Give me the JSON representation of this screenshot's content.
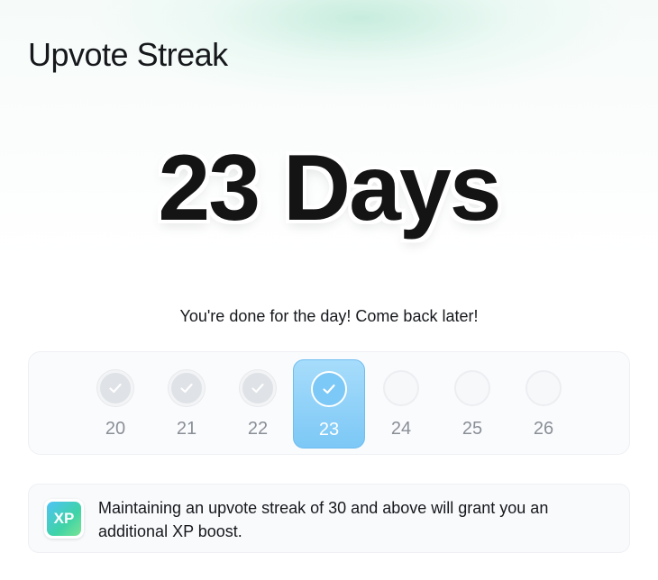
{
  "header": {
    "title": "Upvote Streak"
  },
  "streak": {
    "count_label": "23 Days",
    "message": "You're done for the day! Come back later!",
    "days": [
      {
        "label": "20",
        "state": "done"
      },
      {
        "label": "21",
        "state": "done"
      },
      {
        "label": "22",
        "state": "done"
      },
      {
        "label": "23",
        "state": "today"
      },
      {
        "label": "24",
        "state": "future"
      },
      {
        "label": "25",
        "state": "future"
      },
      {
        "label": "26",
        "state": "future"
      }
    ]
  },
  "info": {
    "badge_text": "XP",
    "text": "Maintaining an upvote streak of 30 and above will grant you an additional XP boost."
  },
  "colors": {
    "today_accent": "#7cc8f6",
    "check_gray": "#ffffff",
    "xp_gradient_start": "#4fc3f7",
    "xp_gradient_end": "#7be495"
  },
  "icons": {
    "done": "checkmark-icon",
    "today": "checkmark-icon",
    "future": "empty-circle-icon"
  }
}
